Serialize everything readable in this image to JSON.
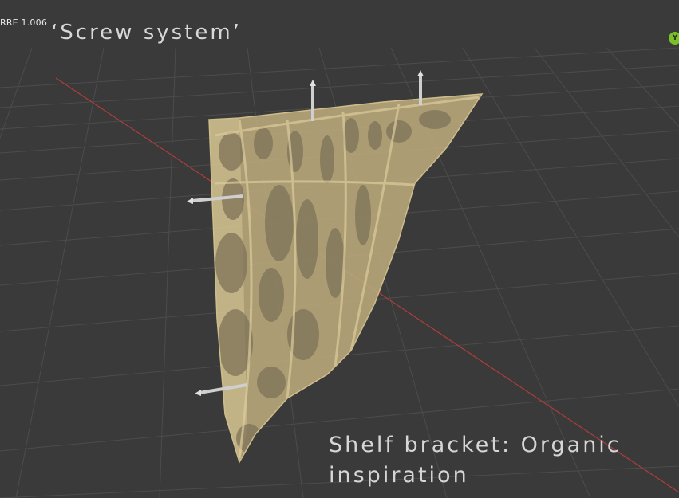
{
  "viewport": {
    "object_label": "RRE 1.006",
    "title": "‘Screw system’",
    "caption_line1": "Shelf bracket: Organic",
    "caption_line2": "inspiration",
    "gizmo_axis": "Y"
  },
  "colors": {
    "background": "#3a3a3a",
    "grid": "#4a4a4a",
    "x_axis": "#b03c3c",
    "bracket": "#c8b88a",
    "bracket_lattice": "#d9c99a",
    "screw": "#c9c9c9",
    "gizmo_y": "#7bbf2a"
  }
}
